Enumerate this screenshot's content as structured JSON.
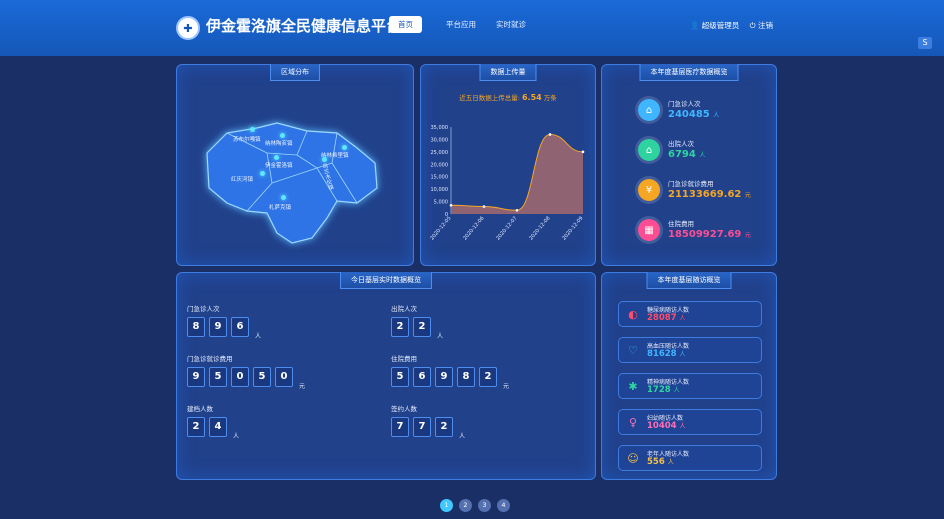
{
  "header": {
    "title": "伊金霍洛旗全民健康信息平台",
    "nav": [
      "首页",
      "平台应用",
      "实时就诊"
    ],
    "user": "超级管理员",
    "logout": "注销"
  },
  "map_panel": {
    "title": "区域分布",
    "towns": [
      "苏布尔嘎镇",
      "纳林陶亥镇",
      "伊金霍洛镇",
      "纳林希里镇",
      "乌兰木伦镇",
      "红庆河镇",
      "札萨克镇"
    ]
  },
  "upload_panel": {
    "title": "数据上传量",
    "subtitle_prefix": "近五日数据上传总量:",
    "subtitle_value": "6.54",
    "subtitle_unit": "万条"
  },
  "chart_data": {
    "type": "area",
    "x": [
      "2020-12-05",
      "2020-12-06",
      "2020-12-07",
      "2020-12-08",
      "2020-12-09"
    ],
    "series": [
      {
        "values": [
          3500,
          3000,
          1500,
          32000,
          25000
        ]
      }
    ],
    "yticks": [
      "35,000",
      "30,000",
      "25,000",
      "20,000",
      "15,000",
      "10,000",
      "5,000",
      "0"
    ],
    "ylim": [
      0,
      35000
    ],
    "colors": {
      "line": "#f5a623",
      "fill": "#a36a6e"
    }
  },
  "medical_panel": {
    "title": "本年度基层医疗数据概览",
    "items": [
      {
        "label": "门急诊人次",
        "value": "240485",
        "unit": "人",
        "color": "#3fb6ff",
        "icon": "hospital-icon"
      },
      {
        "label": "出院人次",
        "value": "6794",
        "unit": "人",
        "color": "#2ed3a0",
        "icon": "house-icon"
      },
      {
        "label": "门急诊就诊费用",
        "value": "21133669.62",
        "unit": "元",
        "color": "#f5a623",
        "icon": "money-icon"
      },
      {
        "label": "住院费用",
        "value": "18509927.69",
        "unit": "元",
        "color": "#ff4d94",
        "icon": "building-icon"
      }
    ]
  },
  "realtime_panel": {
    "title": "今日基层实时数据概览",
    "blocks": [
      {
        "label": "门急诊人次",
        "digits": [
          "8",
          "9",
          "6"
        ],
        "unit": "人"
      },
      {
        "label": "出院人次",
        "digits": [
          "2",
          "2"
        ],
        "unit": "人"
      },
      {
        "label": "门急诊就诊费用",
        "digits": [
          "9",
          "5",
          "0",
          "5",
          "0"
        ],
        "unit": "元"
      },
      {
        "label": "住院费用",
        "digits": [
          "5",
          "6",
          "9",
          "8",
          "2"
        ],
        "unit": "元"
      },
      {
        "label": "建档人数",
        "digits": [
          "2",
          "4"
        ],
        "unit": "人"
      },
      {
        "label": "签约人数",
        "digits": [
          "7",
          "7",
          "2"
        ],
        "unit": "人"
      }
    ]
  },
  "followup_panel": {
    "title": "本年度基层随访概览",
    "items": [
      {
        "label": "糖尿病随访人数",
        "value": "28087",
        "unit": "人",
        "color": "#ff4d6a",
        "icon": "diabetes-icon"
      },
      {
        "label": "高血压随访人数",
        "value": "81628",
        "unit": "人",
        "color": "#3fb6ff",
        "icon": "heartbeat-icon"
      },
      {
        "label": "精神病随访人数",
        "value": "1728",
        "unit": "人",
        "color": "#2ed3a0",
        "icon": "mind-icon"
      },
      {
        "label": "妇幼随访人数",
        "value": "10404",
        "unit": "人",
        "color": "#ff6fb5",
        "icon": "mother-child-icon"
      },
      {
        "label": "老年人随访人数",
        "value": "556",
        "unit": "人",
        "color": "#f5c04a",
        "icon": "elderly-icon"
      }
    ]
  },
  "pager": [
    "1",
    "2",
    "3",
    "4"
  ]
}
